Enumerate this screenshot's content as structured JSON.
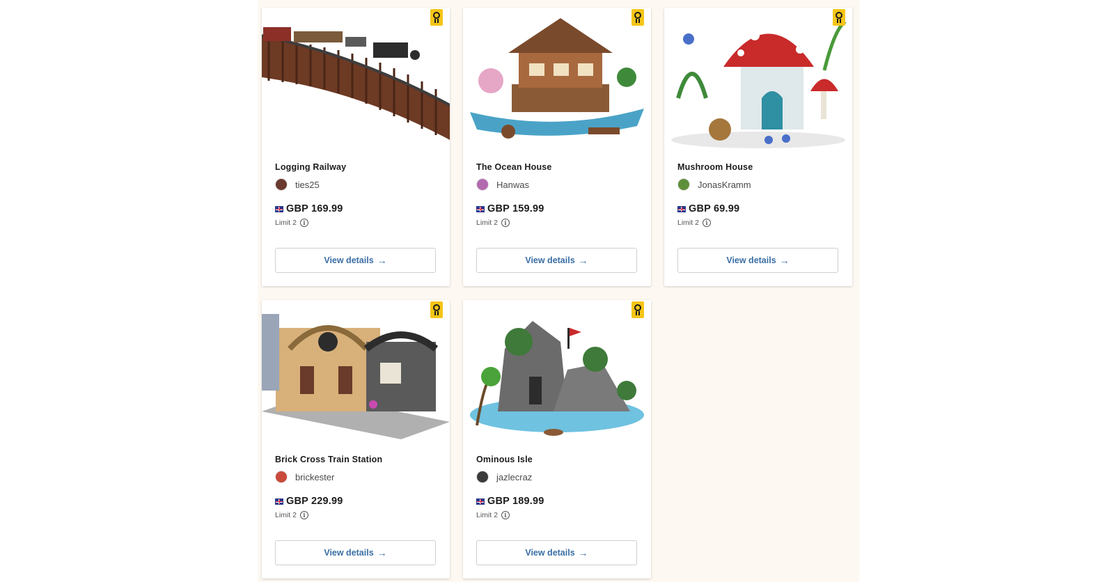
{
  "colors": {
    "page_background": "#fdf9f2",
    "card_background": "#ffffff",
    "badge_yellow": "#f5c518",
    "link_blue": "#3a6ea5"
  },
  "products": [
    {
      "title": "Logging Railway",
      "creator": "ties25",
      "currency_flag": "uk-flag-icon",
      "price": "GBP 169.99",
      "limit": "Limit 2",
      "button_label": "View details",
      "badge_icon": "ideas-badge-icon",
      "image": "logging-railway-image",
      "avatar_color": "#6b3a2e"
    },
    {
      "title": "The Ocean House",
      "creator": "Hanwas",
      "currency_flag": "uk-flag-icon",
      "price": "GBP 159.99",
      "limit": "Limit 2",
      "button_label": "View details",
      "badge_icon": "ideas-badge-icon",
      "image": "ocean-house-image",
      "avatar_color": "#b36bb0"
    },
    {
      "title": "Mushroom House",
      "creator": "JonasKramm",
      "currency_flag": "uk-flag-icon",
      "price": "GBP 69.99",
      "limit": "Limit 2",
      "button_label": "View details",
      "badge_icon": "ideas-badge-icon",
      "image": "mushroom-house-image",
      "avatar_color": "#5e8f3a"
    },
    {
      "title": "Brick Cross Train Station",
      "creator": "brickester",
      "currency_flag": "uk-flag-icon",
      "price": "GBP 229.99",
      "limit": "Limit 2",
      "button_label": "View details",
      "badge_icon": "ideas-badge-icon",
      "image": "train-station-image",
      "avatar_color": "#c94a3a"
    },
    {
      "title": "Ominous Isle",
      "creator": "jazlecraz",
      "currency_flag": "uk-flag-icon",
      "price": "GBP 189.99",
      "limit": "Limit 2",
      "button_label": "View details",
      "badge_icon": "ideas-badge-icon",
      "image": "ominous-isle-image",
      "avatar_color": "#3b3b3b"
    }
  ]
}
